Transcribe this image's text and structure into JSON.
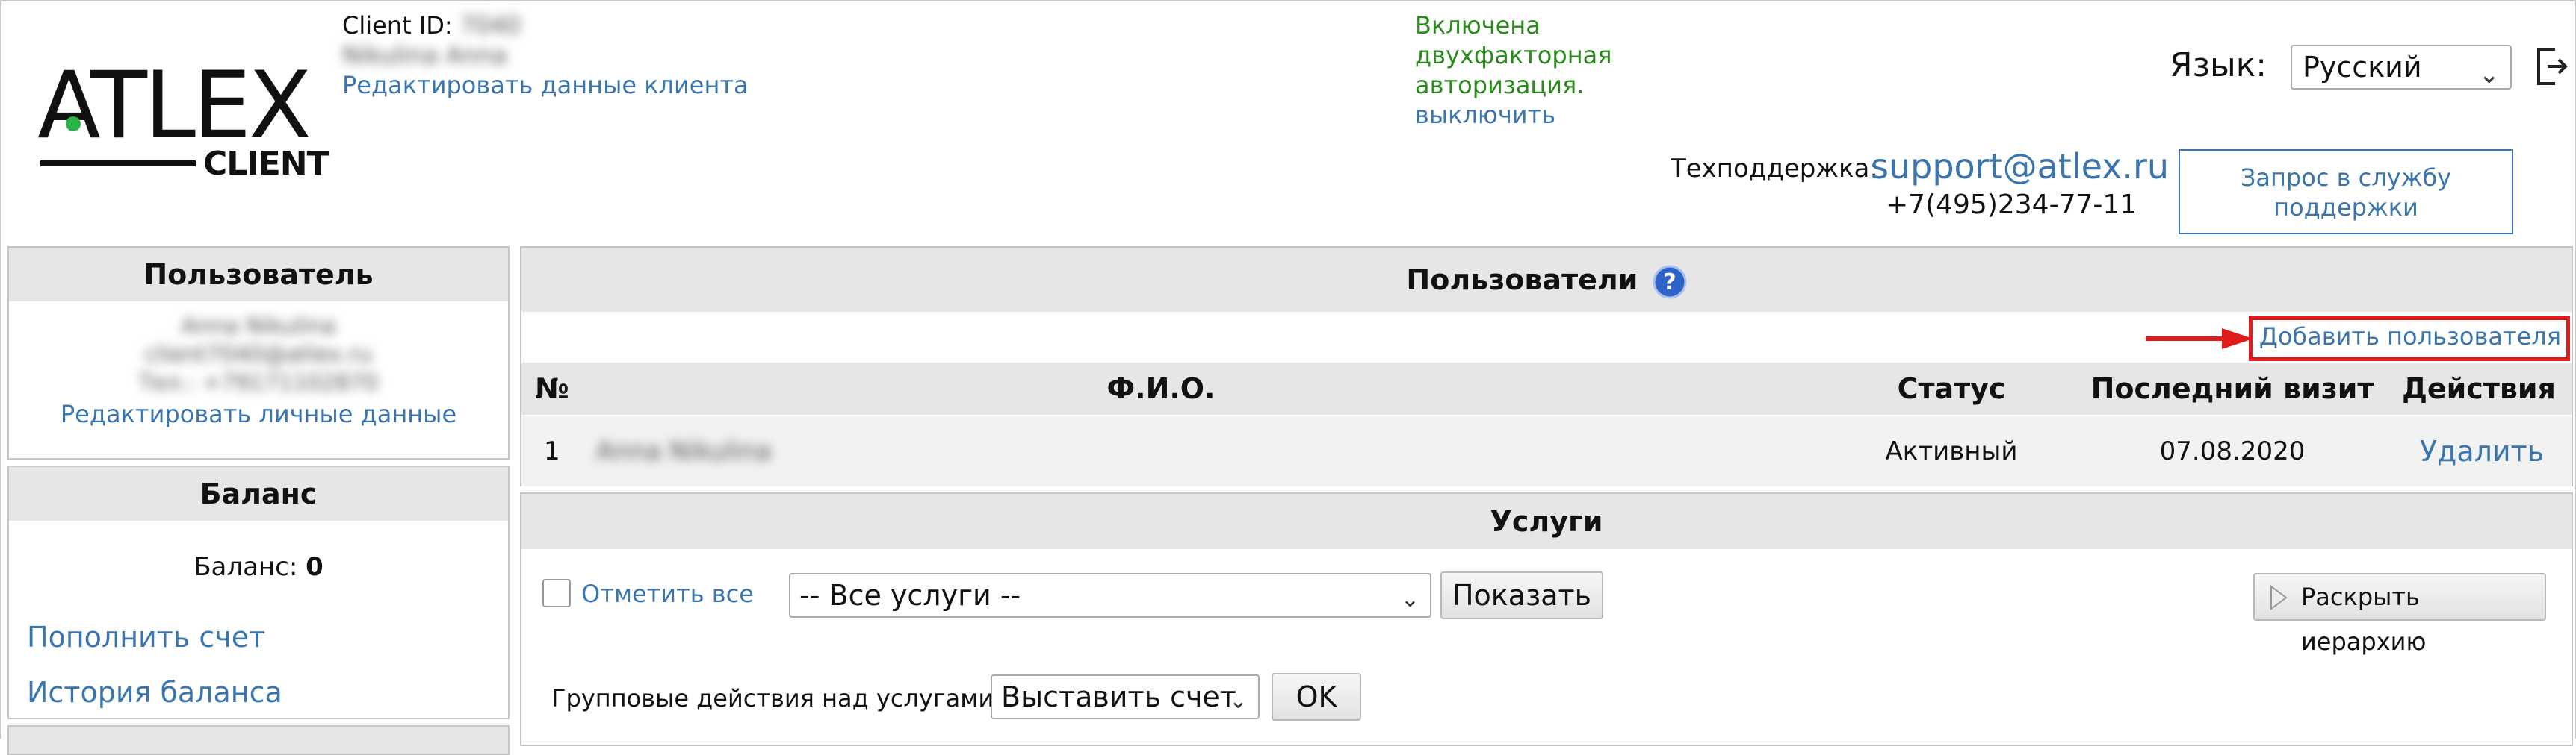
{
  "brand": {
    "logo_text": "ATLEX",
    "logo_sub": "CLIENT"
  },
  "client": {
    "id_label": "Client ID:",
    "id_value": "7040",
    "name": "Nikulina Anna",
    "edit_link": "Редактировать данные клиента"
  },
  "two_factor": {
    "line1": "Включена",
    "line2": "двухфакторная",
    "line3": "авторизация.",
    "disable_link": "выключить"
  },
  "language": {
    "label": "Язык:",
    "selected": "Русский"
  },
  "support": {
    "label": "Техподдержка:",
    "email": "support@atlex.ru",
    "phone": "+7(495)234-77-11",
    "request_button": "Запрос в службу поддержки"
  },
  "user_panel": {
    "title": "Пользователь",
    "name": "Anna Nikulina",
    "email": "client7040@atlex.ru",
    "phone": "Тел.: +79171102870",
    "edit_link": "Редактировать личные данные"
  },
  "balance_panel": {
    "title": "Баланс",
    "balance_label": "Баланс:",
    "balance_value": "0",
    "topup_link": "Пополнить счет",
    "history_link": "История баланса"
  },
  "users_panel": {
    "title": "Пользователи",
    "help_icon": "question-icon",
    "add_link": "Добавить пользователя",
    "columns": {
      "num": "№",
      "name": "Ф.И.О.",
      "status": "Статус",
      "last_visit": "Последний визит",
      "actions": "Действия"
    },
    "rows": [
      {
        "num": "1",
        "name": "Anna Nikulina",
        "status": "Активный",
        "last_visit": "07.08.2020",
        "action": "Удалить"
      }
    ]
  },
  "services_panel": {
    "title": "Услуги",
    "select_all": "Отметить все",
    "filter_selected": "-- Все услуги --",
    "show_button": "Показать",
    "expand_button": "Раскрыть иерархию",
    "group_label": "Групповые действия над услугами",
    "group_selected": "Выставить счет",
    "ok_button": "OK"
  },
  "colors": {
    "link": "#3a76ad",
    "green": "#2a8a1c",
    "highlight": "#e01b1b",
    "panel_header": "#e6e6e6"
  }
}
